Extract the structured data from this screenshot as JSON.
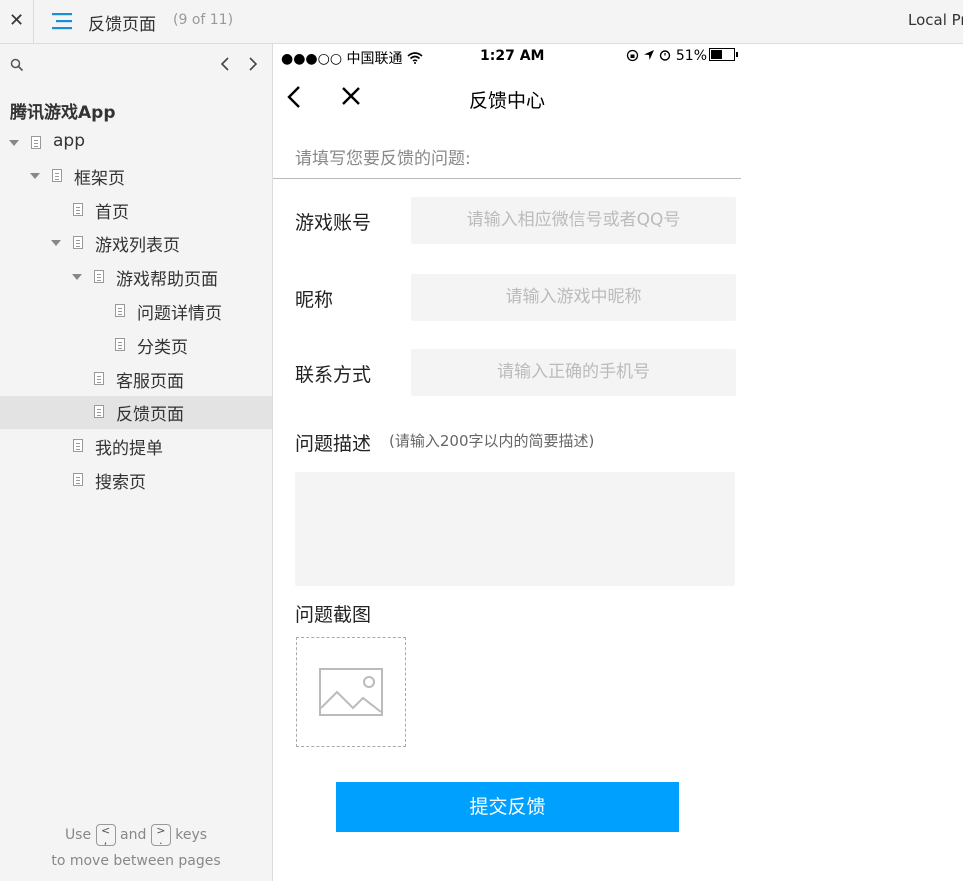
{
  "topbar": {
    "close_glyph": "✕",
    "page_title": "反馈页面",
    "page_count": "(9 of 11)",
    "project_label": "Local Pr"
  },
  "sidebar": {
    "project_name": "腾讯游戏App",
    "tree": [
      {
        "label": "app"
      },
      {
        "label": "框架页"
      },
      {
        "label": "首页"
      },
      {
        "label": "游戏列表页"
      },
      {
        "label": "游戏帮助页面"
      },
      {
        "label": "问题详情页"
      },
      {
        "label": "分类页"
      },
      {
        "label": "客服页面"
      },
      {
        "label": "反馈页面"
      },
      {
        "label": "我的提单"
      },
      {
        "label": "搜索页"
      }
    ],
    "hint": {
      "use": "Use",
      "and": "and",
      "keys": "keys",
      "line2": "to move between pages",
      "key_prev": "<",
      "key_prev_sub": ",",
      "key_next": ">",
      "key_next_sub": "."
    }
  },
  "phone": {
    "status": {
      "carrier": "●●●○○ 中国联通",
      "time": "1:27 AM",
      "battery": "51%",
      "battery_level": 0.51
    },
    "nav_title": "反馈中心",
    "prompt": "请填写您要反馈的问题:",
    "fields": [
      {
        "label": "游戏账号",
        "placeholder": "请输入相应微信号或者QQ号"
      },
      {
        "label": "昵称",
        "placeholder": "请输入游戏中昵称"
      },
      {
        "label": "联系方式",
        "placeholder": "请输入正确的手机号"
      }
    ],
    "desc_label": "问题描述",
    "desc_hint": "(请输入200字以内的简要描述)",
    "screenshot_label": "问题截图",
    "submit": "提交反馈"
  },
  "colors": {
    "accent": "#00a0ff",
    "sidebar_bg": "#f4f4f4",
    "selected_bg": "#e3e3e3",
    "input_bg": "#f4f4f4"
  }
}
